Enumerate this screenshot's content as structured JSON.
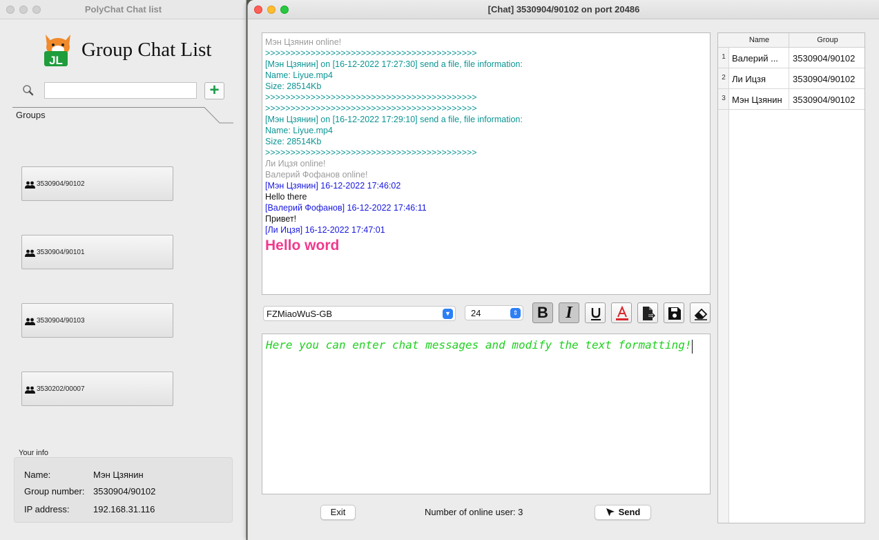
{
  "list_window": {
    "title": "PolyChat Chat list",
    "heading": "Group Chat List",
    "search": {
      "value": "",
      "placeholder": ""
    },
    "add_button_label": "+",
    "groups_tab_label": "Groups",
    "groups": [
      {
        "label": "3530904/90102"
      },
      {
        "label": "3530904/90101"
      },
      {
        "label": "3530904/90103"
      },
      {
        "label": "3530202/00007"
      }
    ],
    "your_info": {
      "caption": "Your info",
      "name_label": "Name:",
      "name_value": "Мэн Цзянин",
      "group_label": "Group number:",
      "group_value": "3530904/90102",
      "ip_label": "IP address:",
      "ip_value": "192.168.31.116"
    }
  },
  "chat_window": {
    "title": "[Chat] 3530904/90102 on port 20486",
    "messages": [
      {
        "text": "Мэн Цзянин online!",
        "style": "gray"
      },
      {
        "text": ">>>>>>>>>>>>>>>>>>>>>>>>>>>>>>>>>>>>>>>>>>",
        "style": "teal"
      },
      {
        "text": "[Мэн Цзянин] on [16-12-2022 17:27:30] send a file, file information:",
        "style": "teal"
      },
      {
        "text": "Name: Liyue.mp4",
        "style": "teal"
      },
      {
        "text": "Size: 28514Kb",
        "style": "teal"
      },
      {
        "text": ">>>>>>>>>>>>>>>>>>>>>>>>>>>>>>>>>>>>>>>>>>",
        "style": "teal"
      },
      {
        "text": ">>>>>>>>>>>>>>>>>>>>>>>>>>>>>>>>>>>>>>>>>>",
        "style": "teal"
      },
      {
        "text": "[Мэн Цзянин] on [16-12-2022 17:29:10] send a file, file information:",
        "style": "teal"
      },
      {
        "text": "Name: Liyue.mp4",
        "style": "teal"
      },
      {
        "text": "Size: 28514Kb",
        "style": "teal"
      },
      {
        "text": ">>>>>>>>>>>>>>>>>>>>>>>>>>>>>>>>>>>>>>>>>>",
        "style": "teal"
      },
      {
        "text": "Ли Ицзя online!",
        "style": "gray"
      },
      {
        "text": "Валерий Фофанов online!",
        "style": "gray"
      },
      {
        "text": "[Мэн Цзянин] 16-12-2022 17:46:02",
        "style": "blue"
      },
      {
        "text": "Hello there",
        "style": "black"
      },
      {
        "text": "[Валерий Фофанов] 16-12-2022 17:46:11",
        "style": "blue"
      },
      {
        "text": "Привет!",
        "style": "black"
      },
      {
        "text": "[Ли Ицзя] 16-12-2022 17:47:01",
        "style": "blue"
      },
      {
        "text": "Hello word",
        "style": "big"
      }
    ],
    "font_select": {
      "value": "FZMiaoWuS-GB"
    },
    "size_select": {
      "value": "24"
    },
    "format_buttons": {
      "bold": "B",
      "italic": "I"
    },
    "compose_text": "Here you can enter chat messages and modify the text formatting!",
    "exit_label": "Exit",
    "online_count_text": "Number of online user: 3",
    "send_label": "Send",
    "user_table": {
      "headers": [
        "Name",
        "Group"
      ],
      "rows": [
        {
          "num": "1",
          "name": "Валерий ...",
          "group": "3530904/90102"
        },
        {
          "num": "2",
          "name": "Ли Ицзя",
          "group": "3530904/90102"
        },
        {
          "num": "3",
          "name": "Мэн Цзянин",
          "group": "3530904/90102"
        }
      ]
    }
  },
  "colors": {
    "system_msg": "#9b9b9b",
    "file_msg": "#0b9494",
    "sender_header": "#1717e0",
    "highlight_msg": "#f03a8e",
    "compose_text": "#1fd01f",
    "add_button": "#1c9c4a"
  },
  "icons": [
    "search-icon",
    "add-icon",
    "group-icon",
    "bold-icon",
    "italic-icon",
    "underline-icon",
    "text-color-icon",
    "send-file-icon",
    "save-icon",
    "eraser-icon",
    "send-cursor-icon"
  ]
}
